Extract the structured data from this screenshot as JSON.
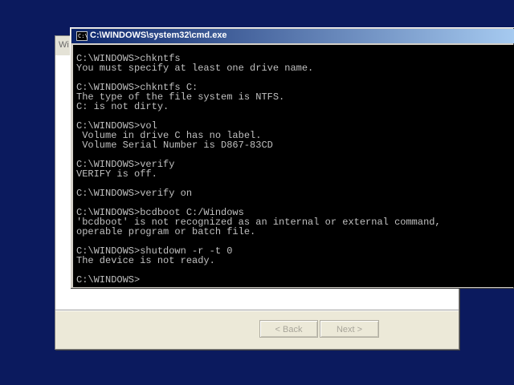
{
  "setup_window": {
    "title": "Wi",
    "back_label": "< Back",
    "next_label": "Next >"
  },
  "cmd_window": {
    "title": "C:\\WINDOWS\\system32\\cmd.exe",
    "icon_glyph": "C:\\",
    "lines": [
      "C:\\WINDOWS>chkntfs",
      "You must specify at least one drive name.",
      "",
      "C:\\WINDOWS>chkntfs C:",
      "The type of the file system is NTFS.",
      "C: is not dirty.",
      "",
      "C:\\WINDOWS>vol",
      " Volume in drive C has no label.",
      " Volume Serial Number is D867-83CD",
      "",
      "C:\\WINDOWS>verify",
      "VERIFY is off.",
      "",
      "C:\\WINDOWS>verify on",
      "",
      "C:\\WINDOWS>bcdboot C:/Windows",
      "'bcdboot' is not recognized as an internal or external command,",
      "operable program or batch file.",
      "",
      "C:\\WINDOWS>shutdown -r -t 0",
      "The device is not ready.",
      "",
      "C:\\WINDOWS>"
    ]
  }
}
